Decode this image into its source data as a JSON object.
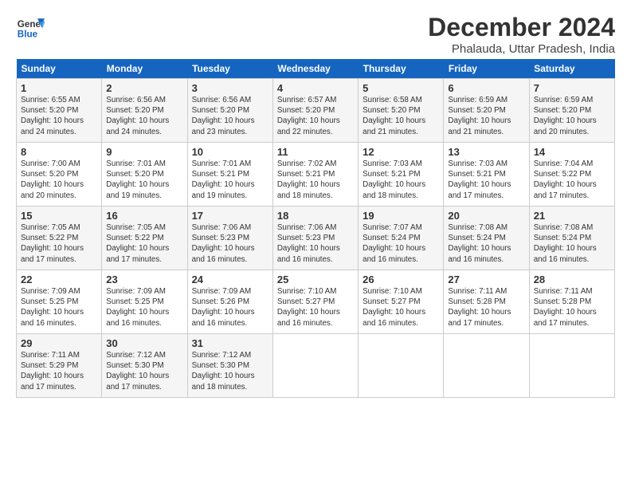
{
  "logo": {
    "line1": "General",
    "line2": "Blue"
  },
  "title": "December 2024",
  "subtitle": "Phalauda, Uttar Pradesh, India",
  "days_header": [
    "Sunday",
    "Monday",
    "Tuesday",
    "Wednesday",
    "Thursday",
    "Friday",
    "Saturday"
  ],
  "weeks": [
    [
      {
        "day": "1",
        "rise": "6:55 AM",
        "set": "5:20 PM",
        "daylight": "10 hours and 24 minutes."
      },
      {
        "day": "2",
        "rise": "6:56 AM",
        "set": "5:20 PM",
        "daylight": "10 hours and 24 minutes."
      },
      {
        "day": "3",
        "rise": "6:56 AM",
        "set": "5:20 PM",
        "daylight": "10 hours and 23 minutes."
      },
      {
        "day": "4",
        "rise": "6:57 AM",
        "set": "5:20 PM",
        "daylight": "10 hours and 22 minutes."
      },
      {
        "day": "5",
        "rise": "6:58 AM",
        "set": "5:20 PM",
        "daylight": "10 hours and 21 minutes."
      },
      {
        "day": "6",
        "rise": "6:59 AM",
        "set": "5:20 PM",
        "daylight": "10 hours and 21 minutes."
      },
      {
        "day": "7",
        "rise": "6:59 AM",
        "set": "5:20 PM",
        "daylight": "10 hours and 20 minutes."
      }
    ],
    [
      {
        "day": "8",
        "rise": "7:00 AM",
        "set": "5:20 PM",
        "daylight": "10 hours and 20 minutes."
      },
      {
        "day": "9",
        "rise": "7:01 AM",
        "set": "5:20 PM",
        "daylight": "10 hours and 19 minutes."
      },
      {
        "day": "10",
        "rise": "7:01 AM",
        "set": "5:21 PM",
        "daylight": "10 hours and 19 minutes."
      },
      {
        "day": "11",
        "rise": "7:02 AM",
        "set": "5:21 PM",
        "daylight": "10 hours and 18 minutes."
      },
      {
        "day": "12",
        "rise": "7:03 AM",
        "set": "5:21 PM",
        "daylight": "10 hours and 18 minutes."
      },
      {
        "day": "13",
        "rise": "7:03 AM",
        "set": "5:21 PM",
        "daylight": "10 hours and 17 minutes."
      },
      {
        "day": "14",
        "rise": "7:04 AM",
        "set": "5:22 PM",
        "daylight": "10 hours and 17 minutes."
      }
    ],
    [
      {
        "day": "15",
        "rise": "7:05 AM",
        "set": "5:22 PM",
        "daylight": "10 hours and 17 minutes."
      },
      {
        "day": "16",
        "rise": "7:05 AM",
        "set": "5:22 PM",
        "daylight": "10 hours and 17 minutes."
      },
      {
        "day": "17",
        "rise": "7:06 AM",
        "set": "5:23 PM",
        "daylight": "10 hours and 16 minutes."
      },
      {
        "day": "18",
        "rise": "7:06 AM",
        "set": "5:23 PM",
        "daylight": "10 hours and 16 minutes."
      },
      {
        "day": "19",
        "rise": "7:07 AM",
        "set": "5:24 PM",
        "daylight": "10 hours and 16 minutes."
      },
      {
        "day": "20",
        "rise": "7:08 AM",
        "set": "5:24 PM",
        "daylight": "10 hours and 16 minutes."
      },
      {
        "day": "21",
        "rise": "7:08 AM",
        "set": "5:24 PM",
        "daylight": "10 hours and 16 minutes."
      }
    ],
    [
      {
        "day": "22",
        "rise": "7:09 AM",
        "set": "5:25 PM",
        "daylight": "10 hours and 16 minutes."
      },
      {
        "day": "23",
        "rise": "7:09 AM",
        "set": "5:25 PM",
        "daylight": "10 hours and 16 minutes."
      },
      {
        "day": "24",
        "rise": "7:09 AM",
        "set": "5:26 PM",
        "daylight": "10 hours and 16 minutes."
      },
      {
        "day": "25",
        "rise": "7:10 AM",
        "set": "5:27 PM",
        "daylight": "10 hours and 16 minutes."
      },
      {
        "day": "26",
        "rise": "7:10 AM",
        "set": "5:27 PM",
        "daylight": "10 hours and 16 minutes."
      },
      {
        "day": "27",
        "rise": "7:11 AM",
        "set": "5:28 PM",
        "daylight": "10 hours and 17 minutes."
      },
      {
        "day": "28",
        "rise": "7:11 AM",
        "set": "5:28 PM",
        "daylight": "10 hours and 17 minutes."
      }
    ],
    [
      {
        "day": "29",
        "rise": "7:11 AM",
        "set": "5:29 PM",
        "daylight": "10 hours and 17 minutes."
      },
      {
        "day": "30",
        "rise": "7:12 AM",
        "set": "5:30 PM",
        "daylight": "10 hours and 17 minutes."
      },
      {
        "day": "31",
        "rise": "7:12 AM",
        "set": "5:30 PM",
        "daylight": "10 hours and 18 minutes."
      },
      null,
      null,
      null,
      null
    ]
  ],
  "labels": {
    "sunrise": "Sunrise:",
    "sunset": "Sunset:",
    "daylight": "Daylight:"
  }
}
